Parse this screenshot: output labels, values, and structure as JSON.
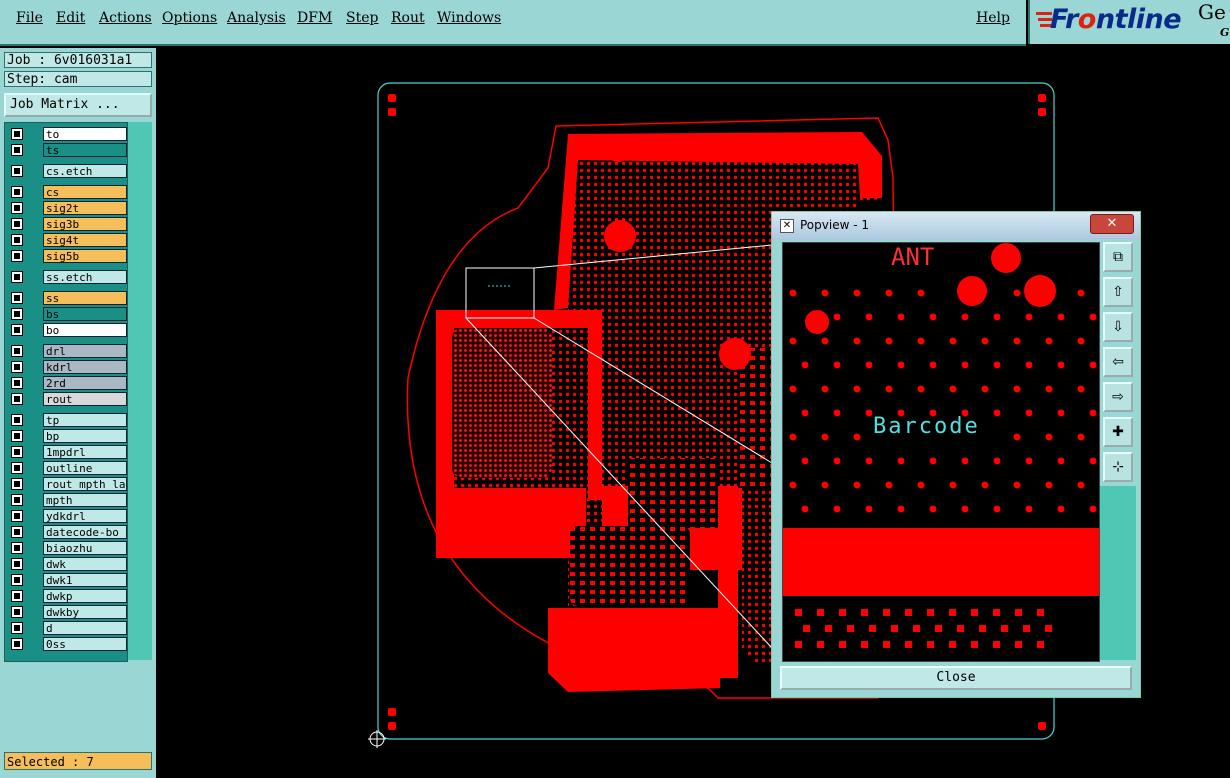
{
  "menu": {
    "items": [
      "File",
      "Edit",
      "Actions",
      "Options",
      "Analysis",
      "DFM",
      "Step",
      "Rout",
      "Windows"
    ],
    "help": "Help"
  },
  "logo": {
    "text_pre": "Fr",
    "text_o": "o",
    "text_post": "ntline",
    "extra": "Ge",
    "sub": "G."
  },
  "job": {
    "label": "Job : 6v016031a1"
  },
  "step": {
    "label": "Step: cam"
  },
  "matrix_button": "Job Matrix ...",
  "layers": [
    {
      "name": "to",
      "color": "#ffffff"
    },
    {
      "name": "ts",
      "color": "#1a8f86"
    },
    {
      "name": "cs.etch",
      "color": "#bfe8e6"
    },
    {
      "name": "cs",
      "color": "#f5be5b"
    },
    {
      "name": "sig2t",
      "color": "#f5be5b"
    },
    {
      "name": "sig3b",
      "color": "#f5be5b"
    },
    {
      "name": "sig4t",
      "color": "#f5be5b"
    },
    {
      "name": "sig5b",
      "color": "#f5be5b"
    },
    {
      "name": "ss.etch",
      "color": "#bfe8e6"
    },
    {
      "name": "ss",
      "color": "#f5be5b"
    },
    {
      "name": "bs",
      "color": "#1a8f86"
    },
    {
      "name": "bo",
      "color": "#ffffff"
    },
    {
      "name": "drl",
      "color": "#a9b8c2"
    },
    {
      "name": "kdrl",
      "color": "#a9b8c2"
    },
    {
      "name": "2rd",
      "color": "#a9b8c2"
    },
    {
      "name": "rout",
      "color": "#d8d8d8"
    },
    {
      "name": "tp",
      "color": "#bfe8e6"
    },
    {
      "name": "bp",
      "color": "#bfe8e6"
    },
    {
      "name": "1mpdrl",
      "color": "#bfe8e6"
    },
    {
      "name": "outline",
      "color": "#bfe8e6"
    },
    {
      "name": "rout_mpth_la",
      "color": "#bfe8e6"
    },
    {
      "name": "mpth",
      "color": "#bfe8e6"
    },
    {
      "name": "ydkdrl",
      "color": "#bfe8e6"
    },
    {
      "name": "datecode-bo",
      "color": "#bfe8e6"
    },
    {
      "name": "biaozhu",
      "color": "#bfe8e6"
    },
    {
      "name": "dwk",
      "color": "#bfe8e6"
    },
    {
      "name": "dwk1",
      "color": "#bfe8e6"
    },
    {
      "name": "dwkp",
      "color": "#bfe8e6"
    },
    {
      "name": "dwkby",
      "color": "#bfe8e6"
    },
    {
      "name": "d",
      "color": "#bfe8e6"
    },
    {
      "name": "0ss",
      "color": "#bfe8e6"
    }
  ],
  "selected": {
    "label": "Selected : 7"
  },
  "popview": {
    "title": "Popview - 1",
    "close_x": "✕",
    "close_button": "Close",
    "view_label_ant": "ANT",
    "view_label_barcode": "Barcode",
    "tools": [
      "zoom-fit-icon",
      "pan-up-icon",
      "pan-down-icon",
      "pan-left-icon",
      "pan-right-icon",
      "zoom-in-icon",
      "zoom-out-icon"
    ]
  },
  "colors": {
    "copper": "#ff0000",
    "outline": "#4fd3d3",
    "panel": "#9ad6d3",
    "dark_teal": "#1a8f86"
  }
}
